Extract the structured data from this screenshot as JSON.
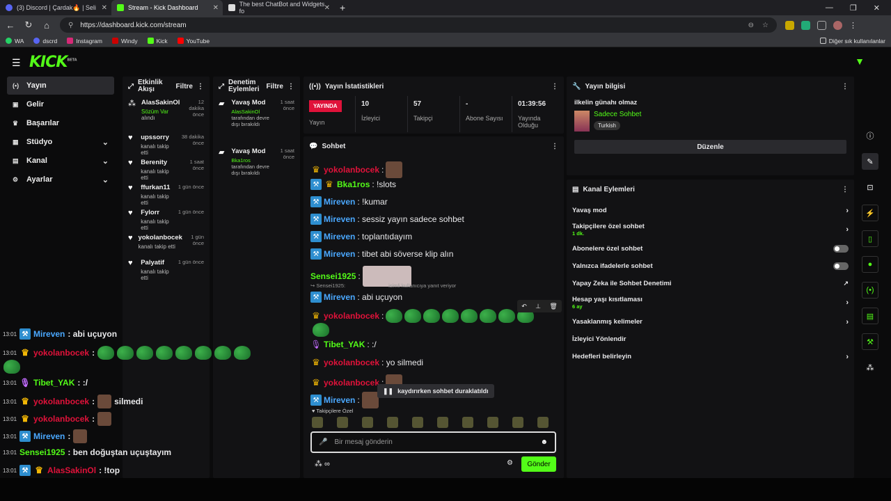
{
  "browser": {
    "tabs": [
      {
        "title": "(3) Discord | Çardak🔥 | Seli",
        "active": false
      },
      {
        "title": "Stream - Kick Dashboard",
        "active": true
      },
      {
        "title": "The best ChatBot and Widgets fo",
        "active": false
      }
    ],
    "url": "https://dashboard.kick.com/stream",
    "bookmarks": [
      "WA",
      "dscrd",
      "Instagram",
      "Windy",
      "Kick",
      "YouTube"
    ],
    "other_bookmarks": "Diğer sık kullanılanlar"
  },
  "sidebar": {
    "items": [
      {
        "label": "Yayın",
        "icon": "broadcast-icon",
        "active": true
      },
      {
        "label": "Gelir",
        "icon": "revenue-icon"
      },
      {
        "label": "Başarılar",
        "icon": "trophy-icon"
      },
      {
        "label": "Stüdyo",
        "icon": "studio-icon",
        "chev": "⌄"
      },
      {
        "label": "Kanal",
        "icon": "channel-icon",
        "chev": "⌄"
      },
      {
        "label": "Ayarlar",
        "icon": "gear-icon",
        "chev": "⌄"
      }
    ]
  },
  "activity": {
    "title": "Etkinlik Akışı",
    "filter": "Filtre",
    "items": [
      {
        "name": "AlasSakinOl",
        "sub": "Sözüm Var",
        "sub2": " alındı",
        "time": "12 dakika önce"
      },
      {
        "name": "upssorry",
        "sub": "kanalı takip etti",
        "time": "38 dakika önce"
      },
      {
        "name": "Berenity",
        "sub": "kanalı takip etti",
        "time": "1 saat önce"
      },
      {
        "name": "ffurkan11",
        "sub": "kanalı takip etti",
        "time": "1 gün önce"
      },
      {
        "name": "Fylorr",
        "sub": "kanalı takip etti",
        "time": "1 gün önce"
      },
      {
        "name": "yokolanbocek",
        "sub": "kanalı takip etti",
        "time": "1 gün önce"
      },
      {
        "name": "Palyatif",
        "sub": "kanalı takip etti",
        "time": "1 gün önce"
      }
    ]
  },
  "moderation": {
    "title": "Denetim Eylemleri",
    "filter": "Filtre",
    "items": [
      {
        "name": "Yavaş Mod",
        "who": "AlasSakinOl",
        "text": " tarafından devre dışı bırakıldı",
        "time": "1 saat önce"
      },
      {
        "name": "Yavaş Mod",
        "who": "Bka1ros",
        "text": " tarafından devre dışı bırakıldı",
        "time": "1 saat önce"
      }
    ]
  },
  "stats": {
    "title": "Yayın İstatistikleri",
    "live": "YAYINDA",
    "items": [
      {
        "v": "",
        "l": "Yayın"
      },
      {
        "v": "10",
        "l": "İzleyici"
      },
      {
        "v": "57",
        "l": "Takipçi"
      },
      {
        "v": "-",
        "l": "Abone Sayısı"
      },
      {
        "v": "01:39:56",
        "l": "Yayında Olduğu"
      }
    ]
  },
  "chat": {
    "title": "Sohbet",
    "messages": [
      {
        "user": "yokolanbocek",
        "color": "#e0123a",
        "text": ":",
        "badge": "crown"
      },
      {
        "user": "Bka1ros",
        "color": "#53fc18",
        "text": ": !slots",
        "badge": "mod-crown"
      },
      {
        "user": "Mireven",
        "color": "#4aa8ff",
        "text": ": !kumar",
        "badge": "mod"
      },
      {
        "user": "Mireven",
        "color": "#4aa8ff",
        "text": ": sessiz yayın sadece sohbet",
        "badge": "mod"
      },
      {
        "user": "Mireven",
        "color": "#4aa8ff",
        "text": ": toplantıdayım",
        "badge": "mod"
      },
      {
        "user": "Mireven",
        "color": "#4aa8ff",
        "text": ": tibet abi söverse klip alın",
        "badge": "mod"
      },
      {
        "user": "Sensei1925",
        "color": "#53fc18",
        "text": ":",
        "badge": ""
      },
      {
        "user": "Mireven",
        "color": "#4aa8ff",
        "text": ": abi uçuyon",
        "badge": "mod"
      },
      {
        "user": "yokolanbocek",
        "color": "#e0123a",
        "text": ":",
        "badge": "crown"
      },
      {
        "user": "Tibet_YAK",
        "color": "#53fc18",
        "text": ": :/",
        "badge": "mic"
      },
      {
        "user": "yokolanbocek",
        "color": "#e0123a",
        "text": ": yo silmedi",
        "badge": "crown"
      },
      {
        "user": "yokolanbocek",
        "color": "#e0123a",
        "text": ":",
        "badge": "crown"
      },
      {
        "user": "Mireven",
        "color": "#4aa8ff",
        "text": ":",
        "badge": "mod"
      }
    ],
    "reply_note": "Sensei1925:",
    "reply_note2": "isimli kullanıcıya yanıt veriyor",
    "paused": "kaydırırken sohbet duraklatıldı",
    "followers_only": "Takipçilere Özel",
    "placeholder": "Bir mesaj gönderin",
    "send": "Gönder"
  },
  "info": {
    "title": "Yayın bilgisi",
    "stream_title": "ilkelin günahı olmaz",
    "category": "Sadece Sohbet",
    "language": "Turkish",
    "edit": "Düzenle"
  },
  "channel_actions": {
    "title": "Kanal Eylemleri",
    "items": [
      {
        "label": "Yavaş mod",
        "type": "arrow"
      },
      {
        "label": "Takipçilere özel sohbet",
        "sub": "1 dk.",
        "type": "arrow"
      },
      {
        "label": "Abonelere özel sohbet",
        "type": "toggle"
      },
      {
        "label": "Yalnızca ifadelerle sohbet",
        "type": "toggle"
      },
      {
        "label": "Yapay Zeka ile Sohbet Denetimi",
        "type": "ext"
      },
      {
        "label": "Hesap yaşı kısıtlaması",
        "sub": "6 ay",
        "type": "arrow"
      },
      {
        "label": "Yasaklanmış kelimeler",
        "type": "arrow"
      },
      {
        "label": "İzleyici Yönlendir",
        "type": "none"
      },
      {
        "label": "Hedefleri belirleyin",
        "type": "arrow"
      }
    ]
  },
  "overlay": {
    "messages": [
      {
        "time": "13:01",
        "user": "Mireven",
        "color": "#4aa8ff",
        "text": " : abi uçuyon",
        "badge": "mod"
      },
      {
        "time": "13:01",
        "user": "yokolanbocek",
        "color": "#e0123a",
        "text": " :",
        "badge": "crown"
      },
      {
        "time": "13:01",
        "user": "Tibet_YAK",
        "color": "#53fc18",
        "text": " : :/",
        "badge": "mic"
      },
      {
        "time": "13:01",
        "user": "yokolanbocek",
        "color": "#e0123a",
        "text": " :",
        "badge": "crown",
        "tail": " silmedi"
      },
      {
        "time": "13:01",
        "user": "yokolanbocek",
        "color": "#e0123a",
        "text": " :",
        "badge": "crown"
      },
      {
        "time": "13:01",
        "user": "Mireven",
        "color": "#4aa8ff",
        "text": " :",
        "badge": "mod"
      },
      {
        "time": "13:01",
        "user": "Sensei1925",
        "color": "#53fc18",
        "text": " : ben doğuştan uçuştayım",
        "badge": ""
      },
      {
        "time": "13:01",
        "user": "AlasSakinOl",
        "color": "#e0123a",
        "text": " : !top",
        "badge": "mod-crown"
      }
    ]
  }
}
